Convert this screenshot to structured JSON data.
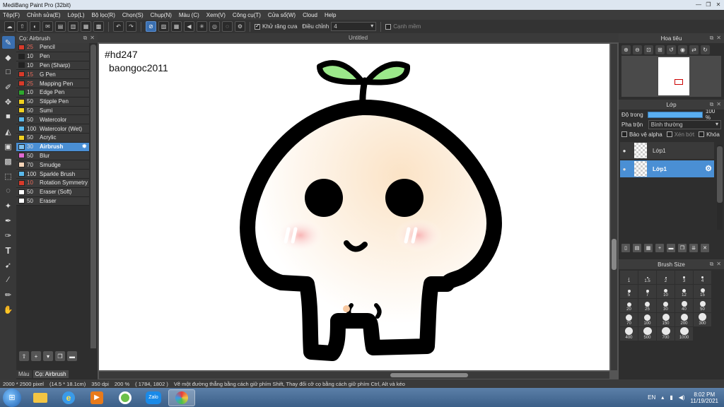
{
  "window": {
    "title": "MediBang Paint Pro (32bit)"
  },
  "menu": [
    "Tệp(F)",
    "Chỉnh sửa(E)",
    "Lớp(L)",
    "Bộ lọc(R)",
    "Chọn(S)",
    "Chụp(N)",
    "Màu (C)",
    "Xem(V)",
    "Công cụ(T)",
    "Cửa sổ(W)",
    "Cloud",
    "Help"
  ],
  "toolbar": {
    "antialias_label": "Khử răng cưa",
    "correction_label": "Điều chỉnh",
    "correction_value": "4",
    "snap_label": "Cạnh mềm"
  },
  "brush_panel": {
    "title": "Cọ: Airbrush",
    "items": [
      {
        "size": "25",
        "name": "Pencil",
        "color": "#d83a2a"
      },
      {
        "size": "10",
        "name": "Pen",
        "color": "#222222"
      },
      {
        "size": "10",
        "name": "Pen (Sharp)",
        "color": "#222222"
      },
      {
        "size": "15",
        "name": "G Pen",
        "color": "#d83a2a"
      },
      {
        "size": "25",
        "name": "Mapping Pen",
        "color": "#d83a2a"
      },
      {
        "size": "10",
        "name": "Edge Pen",
        "color": "#2ea82e"
      },
      {
        "size": "50",
        "name": "Stipple Pen",
        "color": "#f0d020"
      },
      {
        "size": "50",
        "name": "Sumi",
        "color": "#f0d020"
      },
      {
        "size": "50",
        "name": "Watercolor",
        "color": "#5ab8ea"
      },
      {
        "size": "100",
        "name": "Watercolor (Wet)",
        "color": "#5ab8ea"
      },
      {
        "size": "50",
        "name": "Acrylic",
        "color": "#f0d020"
      },
      {
        "size": "30",
        "name": "Airbrush",
        "color": "#7ec0ee"
      },
      {
        "size": "50",
        "name": "Blur",
        "color": "#e06ad0"
      },
      {
        "size": "70",
        "name": "Smudge",
        "color": "#f4d4b8"
      },
      {
        "size": "100",
        "name": "Sparkle Brush",
        "color": "#5ab8ea"
      },
      {
        "size": "10",
        "name": "Rotation Symmetry",
        "color": "#d83a2a"
      },
      {
        "size": "50",
        "name": "Eraser (Soft)",
        "color": "#ffffff"
      },
      {
        "size": "50",
        "name": "Eraser",
        "color": "#ffffff"
      }
    ],
    "tabs": [
      "Màu",
      "Cọ: Airbrush"
    ]
  },
  "canvas": {
    "tab_title": "Untitled",
    "text_line1": "#hd247",
    "text_line2": "baongoc2011"
  },
  "navigator": {
    "title": "Hoa tiêu"
  },
  "layer_panel": {
    "title": "Lớp",
    "opacity_label": "Độ trong",
    "opacity_value": "100 %",
    "opacity_fraction": 1.0,
    "blend_label": "Pha trộn",
    "blend_value": "Bình thường",
    "protect_alpha_label": "Bảo vệ alpha",
    "clipping_label": "Xén bớt",
    "lock_label": "Khóa",
    "layers": [
      {
        "name": "Lớp1",
        "selected": false
      },
      {
        "name": "Lớp1",
        "selected": true
      }
    ]
  },
  "brush_size_panel": {
    "title": "Brush Size",
    "sizes": [
      "1",
      "1.5",
      "2",
      "3",
      "4",
      "5",
      "7",
      "10",
      "12",
      "15",
      "20",
      "25",
      "30",
      "40",
      "50",
      "70",
      "100",
      "150",
      "200",
      "300",
      "400",
      "500",
      "700",
      "1000"
    ]
  },
  "status_bar": {
    "dimensions": "2000 * 2500 pixel",
    "physical": "(14.5 * 18.1cm)",
    "dpi": "350 dpi",
    "zoom": "200 %",
    "cursor": "( 1784, 1802 )",
    "hint": "Vẽ một đường thẳng bằng cách giữ phím Shift, Thay đổi cỡ cọ bằng cách giữ phím Ctrl, Alt và kéo"
  },
  "taskbar": {
    "lang": "EN",
    "time": "8:02 PM",
    "date": "11/19/2021",
    "zalo_label": "Zalo"
  },
  "colors": {
    "accent": "#4a8fd4",
    "leaf": "#9be88a",
    "panel": "#2e2e2e"
  }
}
